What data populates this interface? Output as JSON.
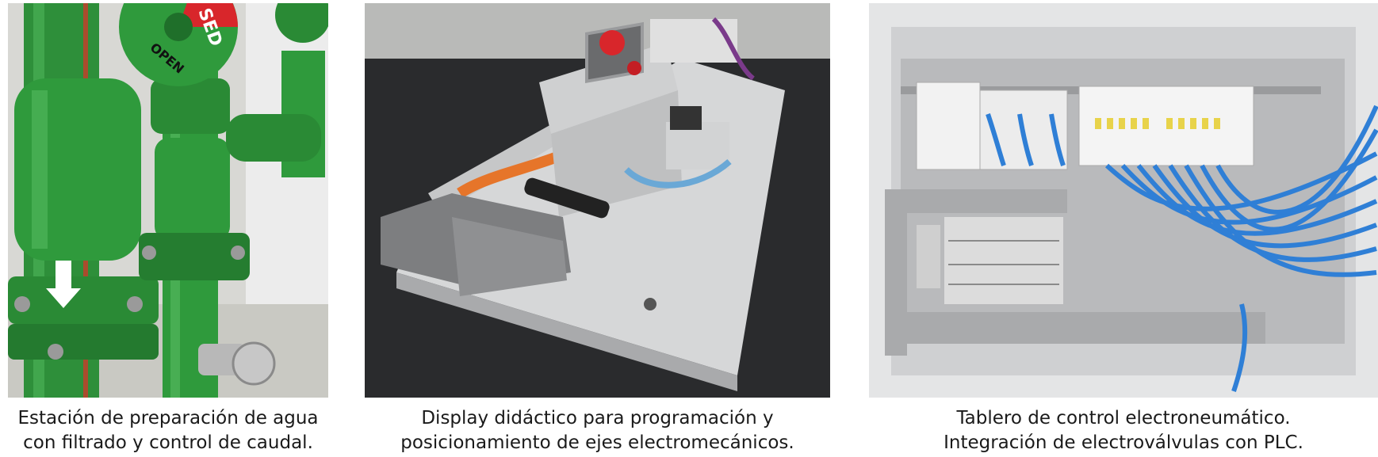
{
  "figures": [
    {
      "caption_lines": [
        "Estación de preparación de agua",
        "con filtrado y control de caudal."
      ],
      "valve_labels": [
        "SED",
        "OPEN"
      ]
    },
    {
      "caption_lines": [
        "Display didáctico para programación y",
        "posicionamiento de ejes electromecánicos."
      ]
    },
    {
      "caption_lines": [
        "Tablero de control electroneumático.",
        "Integración de electroválvulas con PLC."
      ]
    }
  ],
  "colors": {
    "pipe_green": "#2f9a3c",
    "pipe_dark": "#1f6f2a",
    "valve_red": "#d8262b",
    "cable_orange": "#e6752a",
    "tube_blue": "#2f7fd6",
    "panel_grey": "#d9dadb",
    "mat_dark": "#2a2b2d"
  }
}
